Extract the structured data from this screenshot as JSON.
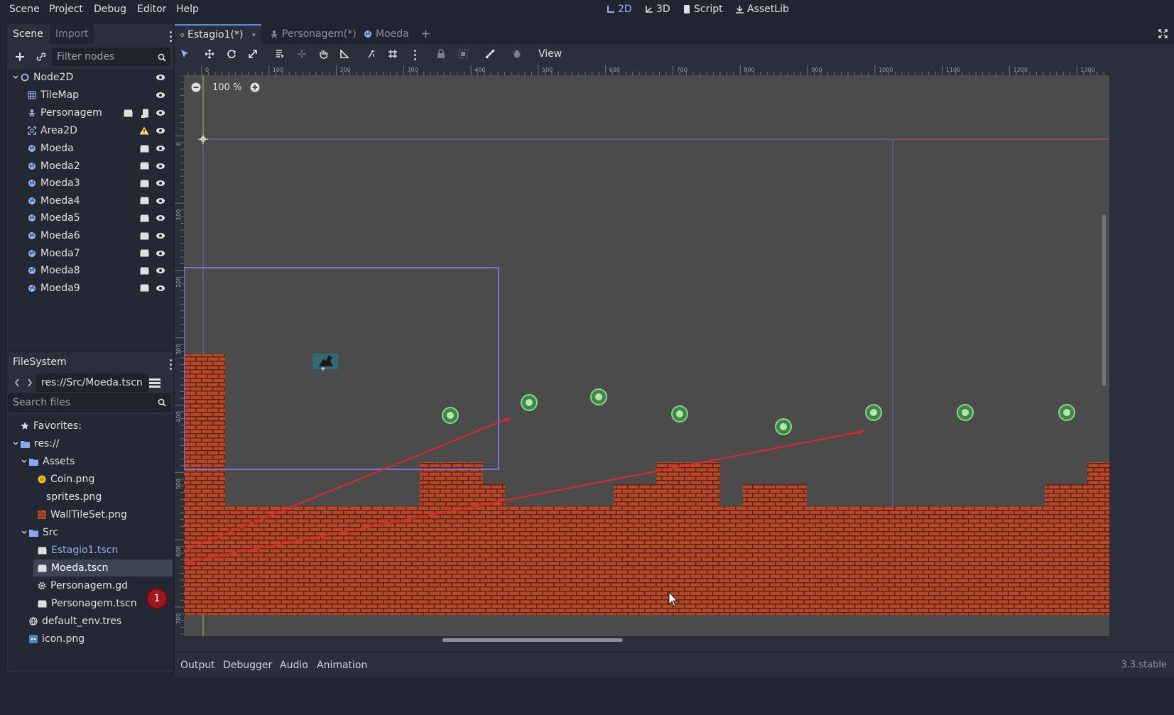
{
  "menu": {
    "items": [
      "Scene",
      "Project",
      "Debug",
      "Editor",
      "Help"
    ],
    "workspaces": [
      "2D",
      "3D",
      "Script",
      "AssetLib"
    ],
    "active_workspace": "2D"
  },
  "scene_dock": {
    "tabs": [
      "Scene",
      "Import"
    ],
    "filter_placeholder": "Filter nodes",
    "nodes": [
      {
        "label": "Node2D",
        "icon": "node2d-circle-icon",
        "badges": []
      },
      {
        "label": "TileMap",
        "icon": "tilemap-icon",
        "badges": []
      },
      {
        "label": "Personagem",
        "icon": "kinematic-body-icon",
        "badges": [
          "instance-icon",
          "script-icon"
        ]
      },
      {
        "label": "Area2D",
        "icon": "area2d-icon",
        "badges": [
          "warning-icon"
        ]
      },
      {
        "label": "Moeda",
        "icon": "globe-icon",
        "badges": [
          "instance-icon"
        ]
      },
      {
        "label": "Moeda2",
        "icon": "globe-icon",
        "badges": [
          "instance-icon"
        ]
      },
      {
        "label": "Moeda3",
        "icon": "globe-icon",
        "badges": [
          "instance-icon"
        ]
      },
      {
        "label": "Moeda4",
        "icon": "globe-icon",
        "badges": [
          "instance-icon"
        ]
      },
      {
        "label": "Moeda5",
        "icon": "globe-icon",
        "badges": [
          "instance-icon"
        ]
      },
      {
        "label": "Moeda6",
        "icon": "globe-icon",
        "badges": [
          "instance-icon"
        ]
      },
      {
        "label": "Moeda7",
        "icon": "globe-icon",
        "badges": [
          "instance-icon"
        ]
      },
      {
        "label": "Moeda8",
        "icon": "globe-icon",
        "badges": [
          "instance-icon"
        ]
      },
      {
        "label": "Moeda9",
        "icon": "globe-icon",
        "badges": [
          "instance-icon"
        ]
      }
    ]
  },
  "filesystem_dock": {
    "title": "FileSystem",
    "path": "res://Src/Moeda.tscn",
    "search_placeholder": "Search files",
    "items": [
      {
        "label": "Favorites:",
        "icon": "star-icon"
      },
      {
        "label": "res://",
        "icon": "folder-icon"
      },
      {
        "label": "Assets",
        "icon": "folder-icon"
      },
      {
        "label": "Coin.png",
        "icon": "coin-image-icon"
      },
      {
        "label": "sprites.png",
        "icon": "blank-icon"
      },
      {
        "label": "WallTileSet.png",
        "icon": "brick-image-icon"
      },
      {
        "label": "Src",
        "icon": "folder-icon"
      },
      {
        "label": "Estagio1.tscn",
        "icon": "scene-file-icon"
      },
      {
        "label": "Moeda.tscn",
        "icon": "scene-file-icon"
      },
      {
        "label": "Personagem.gd",
        "icon": "gear-icon"
      },
      {
        "label": "Personagem.tscn",
        "icon": "scene-file-icon"
      },
      {
        "label": "default_env.tres",
        "icon": "environment-icon"
      },
      {
        "label": "icon.png",
        "icon": "godot-icon"
      }
    ],
    "annotation_badge": "1"
  },
  "editor_tabs": [
    {
      "label": "Estagio1(*)",
      "active": true
    },
    {
      "label": "Personagem(*)",
      "active": false
    },
    {
      "label": "Moeda",
      "active": false
    }
  ],
  "viewport": {
    "view_menu": "View",
    "zoom": "100 %",
    "ruler_h": [
      "0",
      "100",
      "200",
      "300",
      "400",
      "500",
      "600",
      "700",
      "800",
      "900",
      "1000",
      "1100",
      "1200",
      "1300"
    ],
    "ruler_v": [
      "0",
      "100",
      "200",
      "300",
      "400",
      "500",
      "600",
      "700"
    ]
  },
  "bottom_panel": {
    "tabs": [
      "Output",
      "Debugger",
      "Audio",
      "Animation"
    ],
    "version": "3.3.stable"
  },
  "colors": {
    "accent": "#8eb4f5",
    "brick": "#b5482a",
    "annotation": "#a3151a",
    "selection": "#7e72d6"
  }
}
